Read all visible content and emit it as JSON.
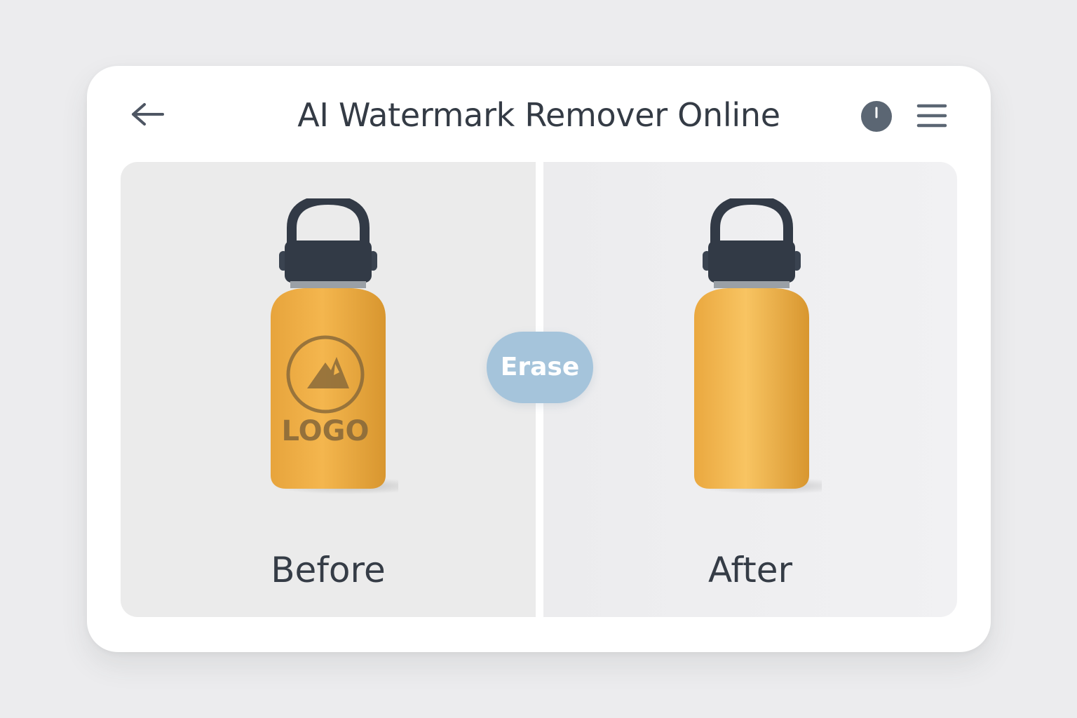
{
  "header": {
    "title": "AI Watermark Remover Online",
    "back_icon": "arrow-left-icon",
    "history_icon": "clock-icon",
    "menu_icon": "hamburger-menu-icon"
  },
  "comparison": {
    "before_label": "Before",
    "after_label": "After",
    "erase_label": "Erase",
    "watermark_text": "LOGO"
  },
  "colors": {
    "accent": "#a5c4db",
    "bottle_body": "#f0b24a",
    "bottle_cap": "#323a46",
    "watermark": "#8a6a3a",
    "text": "#343b45"
  }
}
